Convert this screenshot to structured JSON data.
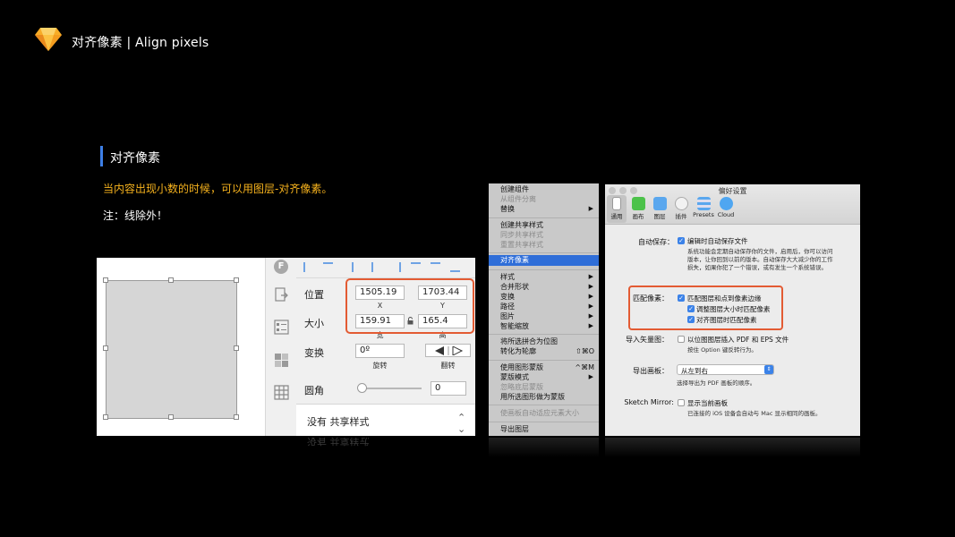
{
  "header": {
    "title": "对齐像素 | Align pixels"
  },
  "section": {
    "heading": "对齐像素",
    "description": "当内容出现小数的时候，可以用图层-对齐像素。",
    "note": "注：线除外！"
  },
  "inspector": {
    "rail_f": "F",
    "position_label": "位置",
    "x_value": "1505.19",
    "y_value": "1703.44",
    "x_sub": "X",
    "y_sub": "Y",
    "size_label": "大小",
    "width_value": "159.91",
    "height_value": "165.4",
    "width_sub": "宽",
    "height_sub": "高",
    "transform_label": "变换",
    "rotate_value": "0º",
    "rotate_sub": "旋转",
    "flip_sub": "翻转",
    "radius_label": "圆角",
    "radius_value": "0",
    "shared_style": "没有 共享样式"
  },
  "context_menu": {
    "items": [
      {
        "label": "创建组件",
        "disabled": false,
        "arrow": false,
        "shortcut": ""
      },
      {
        "label": "从组件分离",
        "disabled": true,
        "arrow": false,
        "shortcut": ""
      },
      {
        "label": "替换",
        "disabled": false,
        "arrow": true,
        "shortcut": ""
      },
      {
        "label": "创建共享样式",
        "disabled": false,
        "arrow": false,
        "shortcut": ""
      },
      {
        "label": "同步共享样式",
        "disabled": true,
        "arrow": false,
        "shortcut": ""
      },
      {
        "label": "重置共享样式",
        "disabled": true,
        "arrow": false,
        "shortcut": ""
      },
      {
        "label": "对齐像素",
        "disabled": false,
        "arrow": false,
        "shortcut": "",
        "selected": true
      },
      {
        "label": "样式",
        "disabled": false,
        "arrow": true,
        "shortcut": ""
      },
      {
        "label": "合并形状",
        "disabled": false,
        "arrow": true,
        "shortcut": ""
      },
      {
        "label": "变换",
        "disabled": false,
        "arrow": true,
        "shortcut": ""
      },
      {
        "label": "路径",
        "disabled": false,
        "arrow": true,
        "shortcut": ""
      },
      {
        "label": "图片",
        "disabled": false,
        "arrow": true,
        "shortcut": ""
      },
      {
        "label": "智能缩放",
        "disabled": false,
        "arrow": true,
        "shortcut": ""
      },
      {
        "label": "将所选拼合为位图",
        "disabled": false,
        "arrow": false,
        "shortcut": ""
      },
      {
        "label": "转化为轮廓",
        "disabled": false,
        "arrow": false,
        "shortcut": "⇧⌘O"
      },
      {
        "label": "使用图形蒙版",
        "disabled": false,
        "arrow": false,
        "shortcut": "^⌘M"
      },
      {
        "label": "蒙版模式",
        "disabled": false,
        "arrow": true,
        "shortcut": ""
      },
      {
        "label": "忽略底层蒙版",
        "disabled": true,
        "arrow": false,
        "shortcut": ""
      },
      {
        "label": "用所选图形做为蒙版",
        "disabled": false,
        "arrow": false,
        "shortcut": ""
      },
      {
        "label": "使画板自动适应元素大小",
        "disabled": true,
        "arrow": false,
        "shortcut": ""
      },
      {
        "label": "导出图层",
        "disabled": false,
        "arrow": false,
        "shortcut": ""
      }
    ]
  },
  "preferences": {
    "window_title": "偏好设置",
    "tabs": [
      {
        "label": "通用",
        "icon": "general-icon",
        "color": "#ffffff"
      },
      {
        "label": "画布",
        "icon": "canvas-icon",
        "color": "#4cc24a"
      },
      {
        "label": "图层",
        "icon": "layers-icon",
        "color": "#5aa7ee"
      },
      {
        "label": "插件",
        "icon": "plugins-icon",
        "color": "#f2f2f2"
      },
      {
        "label": "Presets",
        "icon": "presets-icon",
        "color": "#5aa7ee"
      },
      {
        "label": "Cloud",
        "icon": "cloud-icon",
        "color": "#4fa6f1"
      }
    ],
    "autosave_label": "自动保存：",
    "autosave_check": "编辑时自动保存文件",
    "autosave_desc_1": "系统功能会定期自动保存你的文件，启用后，你可以访问",
    "autosave_desc_2": "版本，让你回到以前的版本。自动保存大大减少你的工作",
    "autosave_desc_3": "损失，如果你犯了一个错误，或有发生一个系统错误。",
    "pixel_label": "匹配像素：",
    "pixel_check_1": "匹配图层和点到像素边缘",
    "pixel_check_2": "调整图层大小时匹配像素",
    "pixel_check_3": "对齐图层时匹配像素",
    "vector_label": "导入矢量图：",
    "vector_check": "以位图图层插入 PDF 和 EPS 文件",
    "vector_hint": "按住 Option 键反转行为。",
    "artboard_label": "导出画板：",
    "artboard_value": "从左到右",
    "artboard_hint": "选择导出为 PDF 画板的顺序。",
    "mirror_label": "Sketch Mirror:",
    "mirror_check": "显示当前画板",
    "mirror_hint": "已连接的 iOS 设备会自动与 Mac 显示相同的画板。"
  },
  "colors": {
    "accent_blue": "#3d7fe6",
    "highlight_orange": "#e35b33",
    "desc_yellow": "#f6b21d",
    "menu_selected": "#2f6ed8"
  }
}
